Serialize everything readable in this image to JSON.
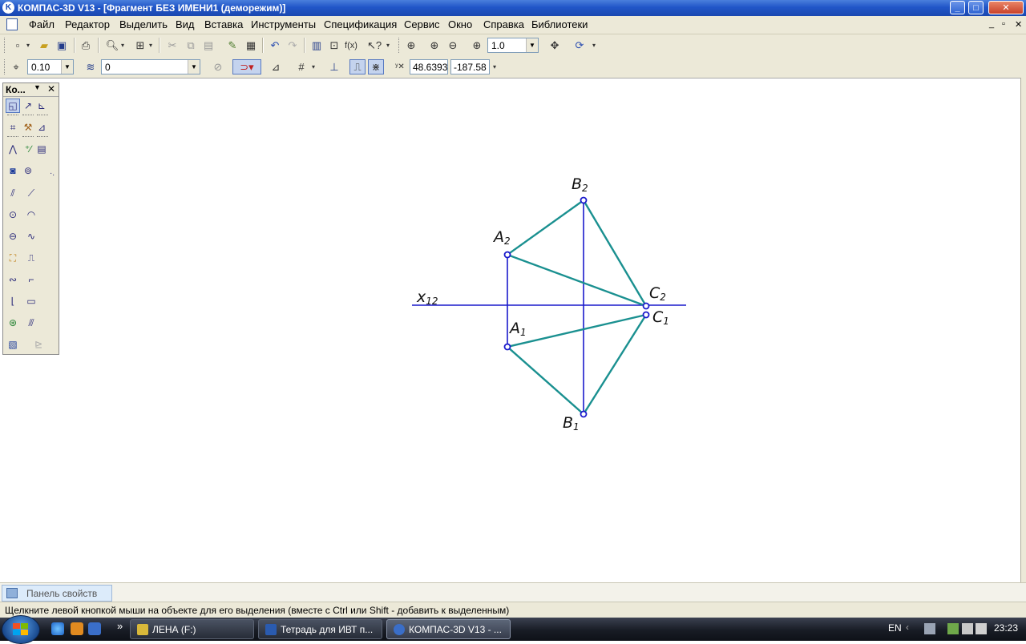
{
  "window": {
    "title": "КОМПАС-3D V13 - [Фрагмент БЕЗ ИМЕНИ1 (деморежим)]",
    "controls": [
      "_",
      "□",
      "✕"
    ]
  },
  "menu": {
    "items": [
      "Файл",
      "Редактор",
      "Выделить",
      "Вид",
      "Вставка",
      "Инструменты",
      "Спецификация",
      "Сервис",
      "Окно",
      "Справка",
      "Библиотеки"
    ],
    "doc_controls": [
      "_",
      "▫",
      "✕"
    ]
  },
  "toolbar1": {
    "zoom_value": "1.0"
  },
  "toolbar2": {
    "step_value": "0.10",
    "layer_value": "0",
    "coord_x": "48.6393",
    "coord_y": "-187.58"
  },
  "compact_panel": {
    "title": "Ко...",
    "close": "✕"
  },
  "drawing": {
    "axis_label": "x",
    "axis_label_sub": "12",
    "line_color": "#1a1acc",
    "edge_color": "#1a9090",
    "points": {
      "A2": {
        "letter": "A",
        "sub": "2"
      },
      "B2": {
        "letter": "B",
        "sub": "2"
      },
      "C2": {
        "letter": "C",
        "sub": "2"
      },
      "A1": {
        "letter": "A",
        "sub": "1"
      },
      "B1": {
        "letter": "B",
        "sub": "1"
      },
      "C1": {
        "letter": "C",
        "sub": "1"
      }
    }
  },
  "properties_tab": {
    "label": "Панель свойств"
  },
  "status": {
    "message": "Щелкните левой кнопкой мыши на объекте для его выделения (вместе с Ctrl или Shift - добавить к выделенным)"
  },
  "taskbar": {
    "chevron": "»",
    "tasks": [
      {
        "label": "ЛЕНА (F:)",
        "color": "#d8b83a"
      },
      {
        "label": "Тетрадь для ИВТ п...",
        "color": "#2a5bb0"
      },
      {
        "label": "КОМПАС-3D V13 - ...",
        "color": "#3a6ec8"
      }
    ],
    "lang": "EN",
    "clock": "23:23"
  }
}
